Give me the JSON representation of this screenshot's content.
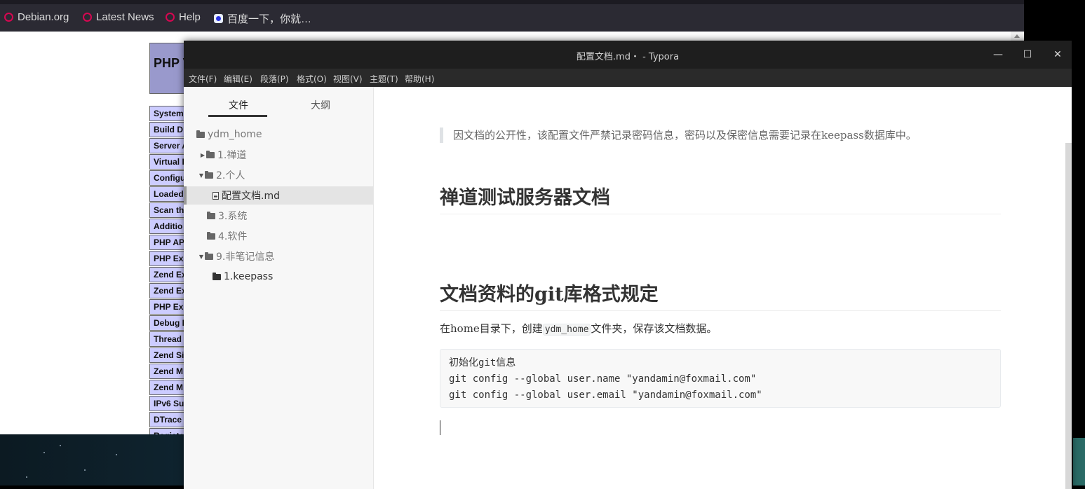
{
  "browser": {
    "bookmarks": [
      {
        "label": "Debian.org",
        "icon": "debian-icon"
      },
      {
        "label": "Latest News",
        "icon": "debian-icon"
      },
      {
        "label": "Help",
        "icon": "debian-icon"
      },
      {
        "label": "百度一下，你就…",
        "icon": "baidu-icon"
      }
    ],
    "php_header": "PHP V",
    "php_rows": [
      "System",
      "Build D",
      "Server A",
      "Virtual I",
      "Configu",
      "Loaded",
      "Scan th",
      "Additio",
      "PHP AP",
      "PHP Ex",
      "Zend Ex",
      "Zend Ex",
      "PHP Ex",
      "Debug I",
      "Thread",
      "Zend Si",
      "Zend M",
      "Zend M",
      "IPv6 Su",
      "DTrace",
      "Registe"
    ]
  },
  "typora": {
    "title": "配置文档.md・ - Typora",
    "menu": [
      "文件(F)",
      "编辑(E)",
      "段落(P)",
      "格式(O)",
      "视图(V)",
      "主题(T)",
      "帮助(H)"
    ],
    "sidebar": {
      "tabs": [
        "文件",
        "大纲"
      ],
      "tree": [
        {
          "label": "ydm_home"
        },
        {
          "label": "1.禅道"
        },
        {
          "label": "2.个人"
        },
        {
          "label": "配置文档.md"
        },
        {
          "label": "3.系统"
        },
        {
          "label": "4.软件"
        },
        {
          "label": "9.非笔记信息"
        },
        {
          "label": "1.keepass"
        }
      ]
    },
    "document": {
      "quote": "因文档的公开性，该配置文件严禁记录密码信息，密码以及保密信息需要记录在keepass数据库中。",
      "heading1": "禅道测试服务器文档",
      "heading2": "文档资料的git库格式规定",
      "para_before": "在home目录下，创建",
      "para_code": "ydm_home",
      "para_after": "文件夹，保存该文档数据。",
      "code_lines": [
        "初始化git信息",
        "git config --global user.name \"yandamin@foxmail.com\"",
        "git config --global user.email \"yandamin@foxmail.com\""
      ]
    }
  }
}
